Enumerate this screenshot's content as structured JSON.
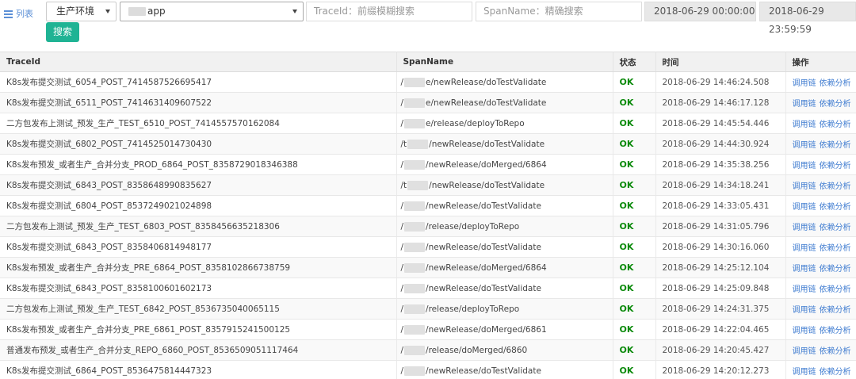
{
  "nav": {
    "list_label": "列表"
  },
  "filters": {
    "env_select": "生产环境",
    "app_select": "app",
    "traceid_placeholder": "TraceId：前缀模糊搜索",
    "spanname_placeholder": "SpanName：精确搜索",
    "start_time": "2018-06-29 00:00:00",
    "end_time": "2018-06-29 23:59:59",
    "search_label": "搜索"
  },
  "table": {
    "headers": [
      "TraceId",
      "SpanName",
      "状态",
      "时间",
      "操作"
    ],
    "op_trace": "调用链",
    "op_dep": "依赖分析",
    "rows": [
      {
        "traceid": "K8s发布提交测试_6054_POST_7414587526695417",
        "span_prefix": "/",
        "span_suffix": "e/newRelease/doTestValidate",
        "status": "OK",
        "time": "2018-06-29 14:46:24.508"
      },
      {
        "traceid": "K8s发布提交测试_6511_POST_7414631409607522",
        "span_prefix": "/",
        "span_suffix": "e/newRelease/doTestValidate",
        "status": "OK",
        "time": "2018-06-29 14:46:17.128"
      },
      {
        "traceid": "二方包发布上测试_预发_生产_TEST_6510_POST_7414557570162084",
        "span_prefix": "/",
        "span_suffix": "e/release/deployToRepo",
        "status": "OK",
        "time": "2018-06-29 14:45:54.446"
      },
      {
        "traceid": "K8s发布提交测试_6802_POST_7414525014730430",
        "span_prefix": "/t",
        "span_suffix": "/newRelease/doTestValidate",
        "status": "OK",
        "time": "2018-06-29 14:44:30.924"
      },
      {
        "traceid": "K8s发布预发_或者生产_合并分支_PROD_6864_POST_8358729018346388",
        "span_prefix": "/",
        "span_suffix": "/newRelease/doMerged/6864",
        "status": "OK",
        "time": "2018-06-29 14:35:38.256"
      },
      {
        "traceid": "K8s发布提交测试_6843_POST_8358648990835627",
        "span_prefix": "/t",
        "span_suffix": "/newRelease/doTestValidate",
        "status": "OK",
        "time": "2018-06-29 14:34:18.241"
      },
      {
        "traceid": "K8s发布提交测试_6804_POST_8537249021024898",
        "span_prefix": "/",
        "span_suffix": "/newRelease/doTestValidate",
        "status": "OK",
        "time": "2018-06-29 14:33:05.431"
      },
      {
        "traceid": "二方包发布上测试_预发_生产_TEST_6803_POST_8358456635218306",
        "span_prefix": "/",
        "span_suffix": "/release/deployToRepo",
        "status": "OK",
        "time": "2018-06-29 14:31:05.796"
      },
      {
        "traceid": "K8s发布提交测试_6843_POST_8358406814948177",
        "span_prefix": "/",
        "span_suffix": "/newRelease/doTestValidate",
        "status": "OK",
        "time": "2018-06-29 14:30:16.060"
      },
      {
        "traceid": "K8s发布预发_或者生产_合并分支_PRE_6864_POST_8358102866738759",
        "span_prefix": "/",
        "span_suffix": "/newRelease/doMerged/6864",
        "status": "OK",
        "time": "2018-06-29 14:25:12.104"
      },
      {
        "traceid": "K8s发布提交测试_6843_POST_8358100601602173",
        "span_prefix": "/",
        "span_suffix": "/newRelease/doTestValidate",
        "status": "OK",
        "time": "2018-06-29 14:25:09.848"
      },
      {
        "traceid": "二方包发布上测试_预发_生产_TEST_6842_POST_8536735040065115",
        "span_prefix": "/",
        "span_suffix": "/release/deployToRepo",
        "status": "OK",
        "time": "2018-06-29 14:24:31.375"
      },
      {
        "traceid": "K8s发布预发_或者生产_合并分支_PRE_6861_POST_8357915241500125",
        "span_prefix": "/",
        "span_suffix": "/newRelease/doMerged/6861",
        "status": "OK",
        "time": "2018-06-29 14:22:04.465"
      },
      {
        "traceid": "普通发布预发_或者生产_合并分支_REPO_6860_POST_8536509051117464",
        "span_prefix": "/",
        "span_suffix": "/release/doMerged/6860",
        "status": "OK",
        "time": "2018-06-29 14:20:45.427"
      },
      {
        "traceid": "K8s发布提交测试_6864_POST_8536475814447323",
        "span_prefix": "/",
        "span_suffix": "/newRelease/doTestValidate",
        "status": "OK",
        "time": "2018-06-29 14:20:12.273"
      }
    ]
  }
}
